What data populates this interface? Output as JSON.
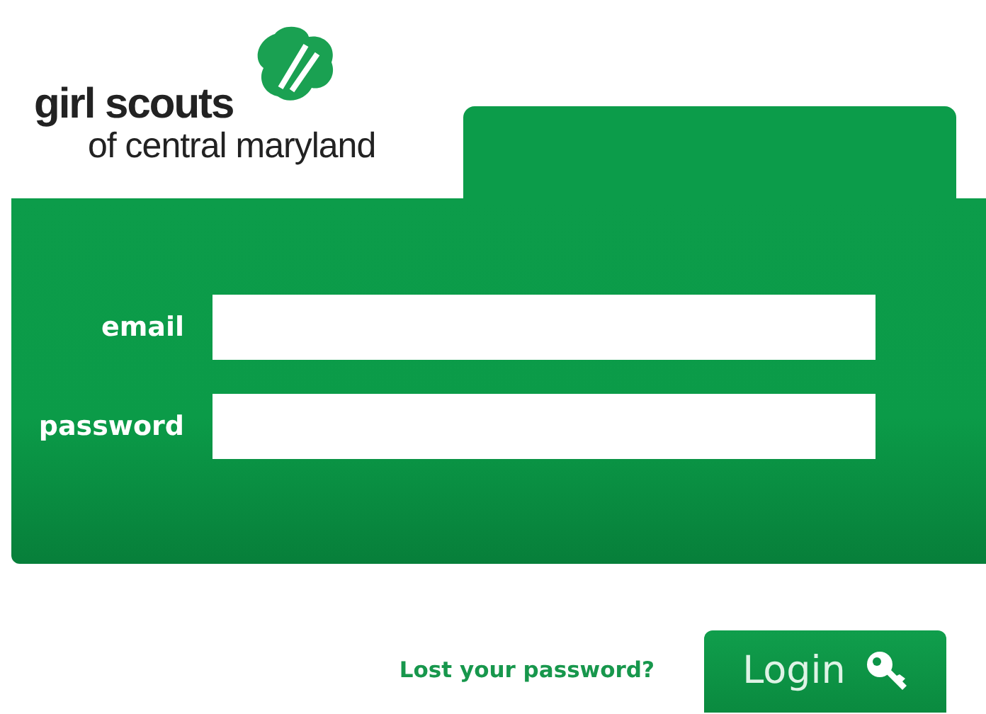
{
  "logo": {
    "line_1": "girl scouts",
    "line_2": "of central maryland"
  },
  "fields": [
    {
      "label": "email"
    },
    {
      "label": "password"
    }
  ],
  "lost_password_link": "Lost your password?",
  "login_button": "Login"
}
